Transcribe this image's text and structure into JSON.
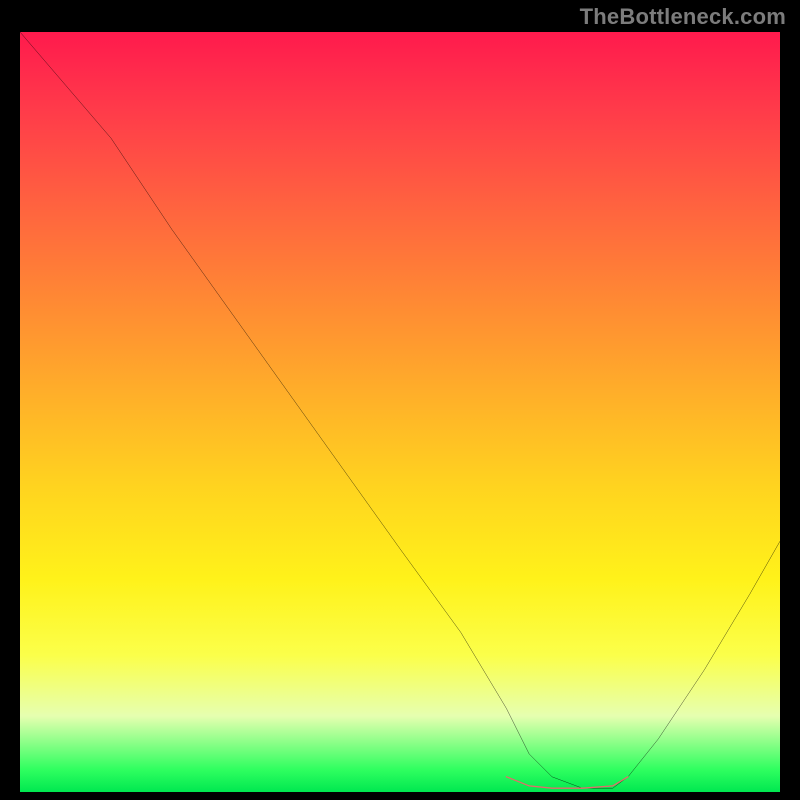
{
  "attribution": "TheBottleneck.com",
  "chart_data": {
    "type": "line",
    "title": "",
    "xlabel": "",
    "ylabel": "",
    "xlim": [
      0,
      100
    ],
    "ylim": [
      0,
      100
    ],
    "series": [
      {
        "name": "black-curve",
        "color": "#000000",
        "x": [
          0,
          6,
          12,
          20,
          30,
          40,
          50,
          58,
          64,
          67,
          70,
          74,
          78,
          80,
          84,
          90,
          96,
          100
        ],
        "y": [
          100,
          93,
          86,
          74,
          60,
          46,
          32,
          21,
          11,
          5,
          2,
          0.5,
          0.5,
          2,
          7,
          16,
          26,
          33
        ]
      },
      {
        "name": "pink-band",
        "color": "#e56b6b",
        "x": [
          64,
          67,
          70,
          74,
          78,
          80
        ],
        "y": [
          2,
          0.8,
          0.5,
          0.5,
          0.8,
          2
        ]
      }
    ]
  }
}
